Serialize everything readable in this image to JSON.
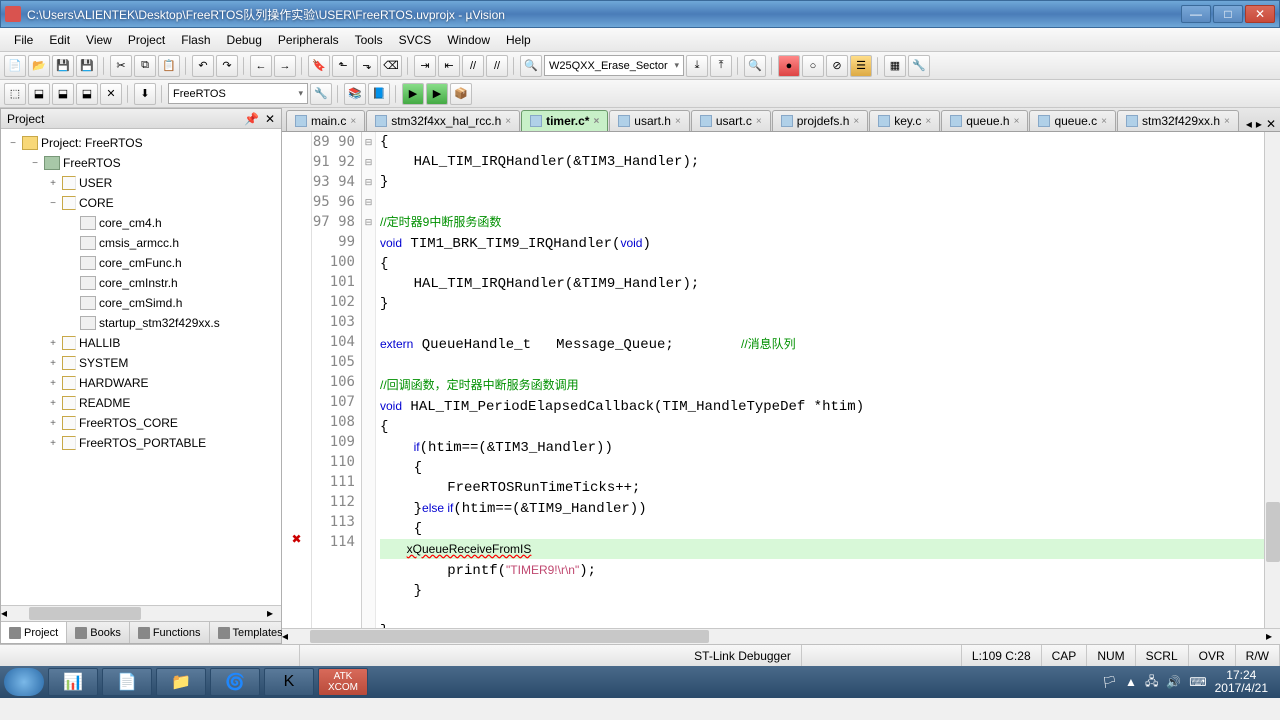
{
  "window": {
    "title": "C:\\Users\\ALIENTEK\\Desktop\\FreeRTOS队列操作实验\\USER\\FreeRTOS.uvprojx - µVision"
  },
  "menu": [
    "File",
    "Edit",
    "View",
    "Project",
    "Flash",
    "Debug",
    "Peripherals",
    "Tools",
    "SVCS",
    "Window",
    "Help"
  ],
  "combo1": "W25QXX_Erase_Sector",
  "target_combo": "FreeRTOS",
  "project_panel": {
    "title": "Project",
    "tabs": [
      "Project",
      "Books",
      "Functions",
      "Templates"
    ],
    "root": "Project: FreeRTOS",
    "tree": [
      {
        "l": 1,
        "exp": "−",
        "ico": "chip",
        "t": "FreeRTOS"
      },
      {
        "l": 2,
        "exp": "+",
        "ico": "fold",
        "t": "USER"
      },
      {
        "l": 2,
        "exp": "−",
        "ico": "fold",
        "t": "CORE"
      },
      {
        "l": 3,
        "exp": "",
        "ico": "file",
        "t": "core_cm4.h"
      },
      {
        "l": 3,
        "exp": "",
        "ico": "file",
        "t": "cmsis_armcc.h"
      },
      {
        "l": 3,
        "exp": "",
        "ico": "file",
        "t": "core_cmFunc.h"
      },
      {
        "l": 3,
        "exp": "",
        "ico": "file",
        "t": "core_cmInstr.h"
      },
      {
        "l": 3,
        "exp": "",
        "ico": "file",
        "t": "core_cmSimd.h"
      },
      {
        "l": 3,
        "exp": "",
        "ico": "file",
        "t": "startup_stm32f429xx.s"
      },
      {
        "l": 2,
        "exp": "+",
        "ico": "fold",
        "t": "HALLIB"
      },
      {
        "l": 2,
        "exp": "+",
        "ico": "fold",
        "t": "SYSTEM"
      },
      {
        "l": 2,
        "exp": "+",
        "ico": "fold",
        "t": "HARDWARE"
      },
      {
        "l": 2,
        "exp": "+",
        "ico": "fold",
        "t": "README"
      },
      {
        "l": 2,
        "exp": "+",
        "ico": "fold",
        "t": "FreeRTOS_CORE"
      },
      {
        "l": 2,
        "exp": "+",
        "ico": "fold",
        "t": "FreeRTOS_PORTABLE"
      }
    ]
  },
  "tabs": [
    {
      "n": "main.c"
    },
    {
      "n": "stm32f4xx_hal_rcc.h"
    },
    {
      "n": "timer.c*",
      "active": true
    },
    {
      "n": "usart.h"
    },
    {
      "n": "usart.c"
    },
    {
      "n": "projdefs.h"
    },
    {
      "n": "key.c"
    },
    {
      "n": "queue.h"
    },
    {
      "n": "queue.c"
    },
    {
      "n": "stm32f429xx.h"
    }
  ],
  "code": {
    "start": 89,
    "lines": [
      {
        "f": "⊟",
        "t": "{"
      },
      {
        "t": "    HAL_TIM_IRQHandler(&TIM3_Handler);"
      },
      {
        "t": "}"
      },
      {
        "t": ""
      },
      {
        "cm": "//定时器9中断服务函数"
      },
      {
        "html": "<span class='kw'>void</span> TIM1_BRK_TIM9_IRQHandler(<span class='kw'>void</span>)"
      },
      {
        "f": "⊟",
        "t": "{"
      },
      {
        "t": "    HAL_TIM_IRQHandler(&TIM9_Handler);"
      },
      {
        "t": "}"
      },
      {
        "t": ""
      },
      {
        "html": "<span class='kw'>extern</span> QueueHandle_t   Message_Queue;        <span class='cm'>//消息队列</span>"
      },
      {
        "t": ""
      },
      {
        "cm": "//回调函数，定时器中断服务函数调用"
      },
      {
        "html": "<span class='kw'>void</span> HAL_TIM_PeriodElapsedCallback(TIM_HandleTypeDef *htim)"
      },
      {
        "f": "⊟",
        "t": "{"
      },
      {
        "html": "    <span class='kw'>if</span>(htim==(&TIM3_Handler))"
      },
      {
        "f": "⊟",
        "t": "    {"
      },
      {
        "t": "        FreeRTOSRunTimeTicks++;"
      },
      {
        "html": "    }<span class='kw'>else if</span>(htim==(&TIM9_Handler))"
      },
      {
        "f": "⊟",
        "t": "    {"
      },
      {
        "err": true,
        "hl": true,
        "html": "        <span class='err'>xQueueReceiveFromIS</span>"
      },
      {
        "html": "        printf(<span class='str'>\"TIMER9!\\r\\n\"</span>);"
      },
      {
        "t": "    }"
      },
      {
        "t": ""
      },
      {
        "t": "}"
      },
      {
        "t": ""
      }
    ]
  },
  "status": {
    "debugger": "ST-Link Debugger",
    "pos": "L:109 C:28",
    "cap": "CAP",
    "num": "NUM",
    "scrl": "SCRL",
    "ovr": "OVR",
    "rw": "R/W"
  },
  "tray": {
    "time": "17:24",
    "date": "2017/4/21"
  },
  "chart_data": null
}
